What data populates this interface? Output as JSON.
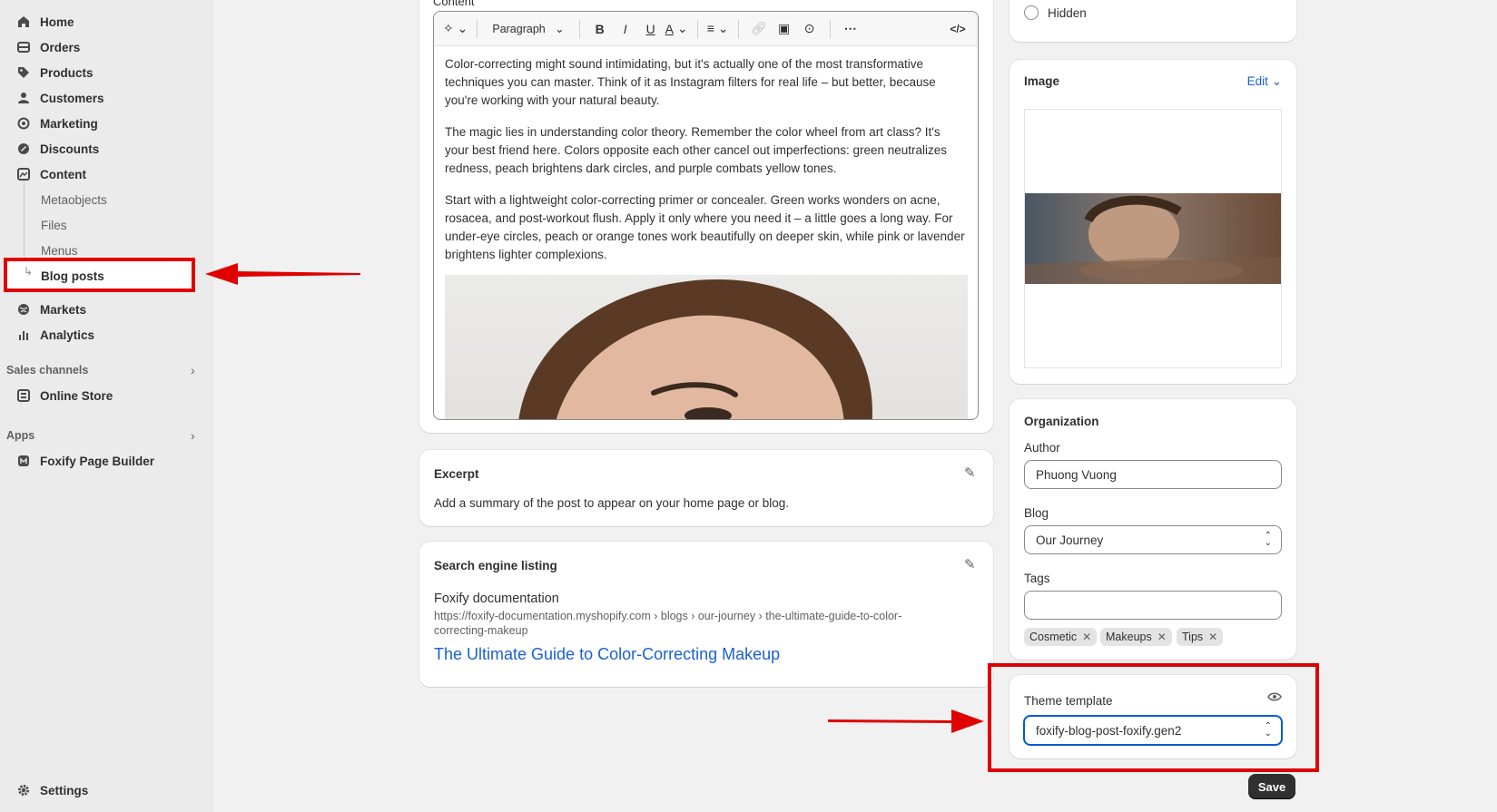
{
  "sidebar": {
    "items": [
      {
        "label": "Home",
        "icon": "home-icon"
      },
      {
        "label": "Orders",
        "icon": "orders-icon"
      },
      {
        "label": "Products",
        "icon": "tag-icon"
      },
      {
        "label": "Customers",
        "icon": "person-icon"
      },
      {
        "label": "Marketing",
        "icon": "target-icon"
      },
      {
        "label": "Discounts",
        "icon": "discount-icon"
      },
      {
        "label": "Content",
        "icon": "content-icon"
      }
    ],
    "content_sub": [
      "Metaobjects",
      "Files",
      "Menus",
      "Blog posts"
    ],
    "items_after": [
      {
        "label": "Markets",
        "icon": "globe-icon"
      },
      {
        "label": "Analytics",
        "icon": "analytics-icon"
      }
    ],
    "sales_channels_label": "Sales channels",
    "online_store": "Online Store",
    "apps_label": "Apps",
    "foxify": "Foxify Page Builder",
    "settings": "Settings"
  },
  "editor": {
    "section_label": "Content",
    "paragraph_select": "Paragraph",
    "paragraphs": [
      "Color-correcting might sound intimidating, but it's actually one of the most transformative techniques you can master. Think of it as Instagram filters for real life – but better, because you're working with your natural beauty.",
      "The magic lies in understanding color theory. Remember the color wheel from art class? It's your best friend here. Colors opposite each other cancel out imperfections: green neutralizes redness, peach brightens dark circles, and purple combats yellow tones.",
      "Start with a lightweight color-correcting primer or concealer. Green works wonders on acne, rosacea, and post-workout flush. Apply it only where you need it – a little goes a long way. For under-eye circles, peach or orange tones work beautifully on deeper skin, while pink or lavender brightens lighter complexions."
    ]
  },
  "excerpt": {
    "title": "Excerpt",
    "text": "Add a summary of the post to appear on your home page or blog."
  },
  "seo": {
    "title": "Search engine listing",
    "site": "Foxify documentation",
    "url": "https://foxify-documentation.myshopify.com › blogs › our-journey › the-ultimate-guide-to-color-correcting-makeup",
    "link": "The Ultimate Guide to Color-Correcting Makeup"
  },
  "visibility": {
    "hidden_label": "Hidden"
  },
  "image": {
    "title": "Image",
    "edit": "Edit"
  },
  "organization": {
    "title": "Organization",
    "author_label": "Author",
    "author_value": "Phuong Vuong",
    "blog_label": "Blog",
    "blog_value": "Our Journey",
    "tags_label": "Tags",
    "tags": [
      "Cosmetic",
      "Makeups",
      "Tips"
    ]
  },
  "theme": {
    "label": "Theme template",
    "value": "foxify-blog-post-foxify.gen2"
  },
  "actions": {
    "save": "Save"
  },
  "colors": {
    "highlight_red": "#e00000",
    "link_blue": "#1a5fd6",
    "focus_blue": "#005bd3"
  }
}
